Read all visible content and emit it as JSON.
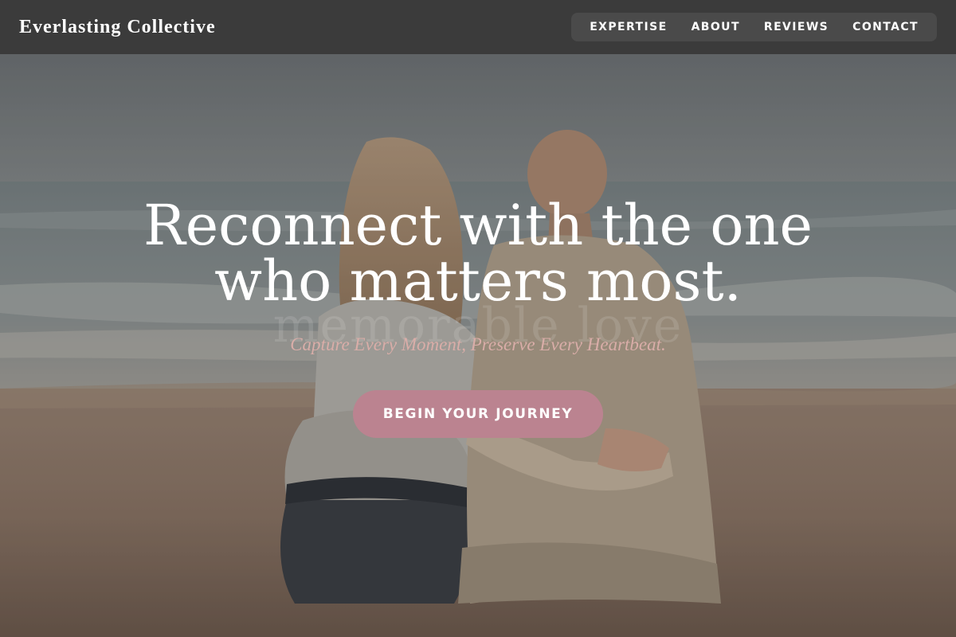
{
  "brand": {
    "name": "Everlasting Collective"
  },
  "nav": {
    "items": [
      {
        "label": "EXPERTISE"
      },
      {
        "label": "ABOUT"
      },
      {
        "label": "REVIEWS"
      },
      {
        "label": "CONTACT"
      }
    ]
  },
  "hero": {
    "headline_line1": "Reconnect with the one",
    "headline_line2": "who matters most.",
    "watermark": "memorable love",
    "tagline": "Capture Every Moment, Preserve Every Heartbeat.",
    "cta_label": "BEGIN YOUR JOURNEY",
    "image_desc": "couple-sitting-on-beach-photo"
  },
  "colors": {
    "nav_bg": "#3b3b3b",
    "nav_menu_bg": "#4a4a4a",
    "cta_bg": "#bb8390",
    "tagline": "#d9ada8"
  }
}
